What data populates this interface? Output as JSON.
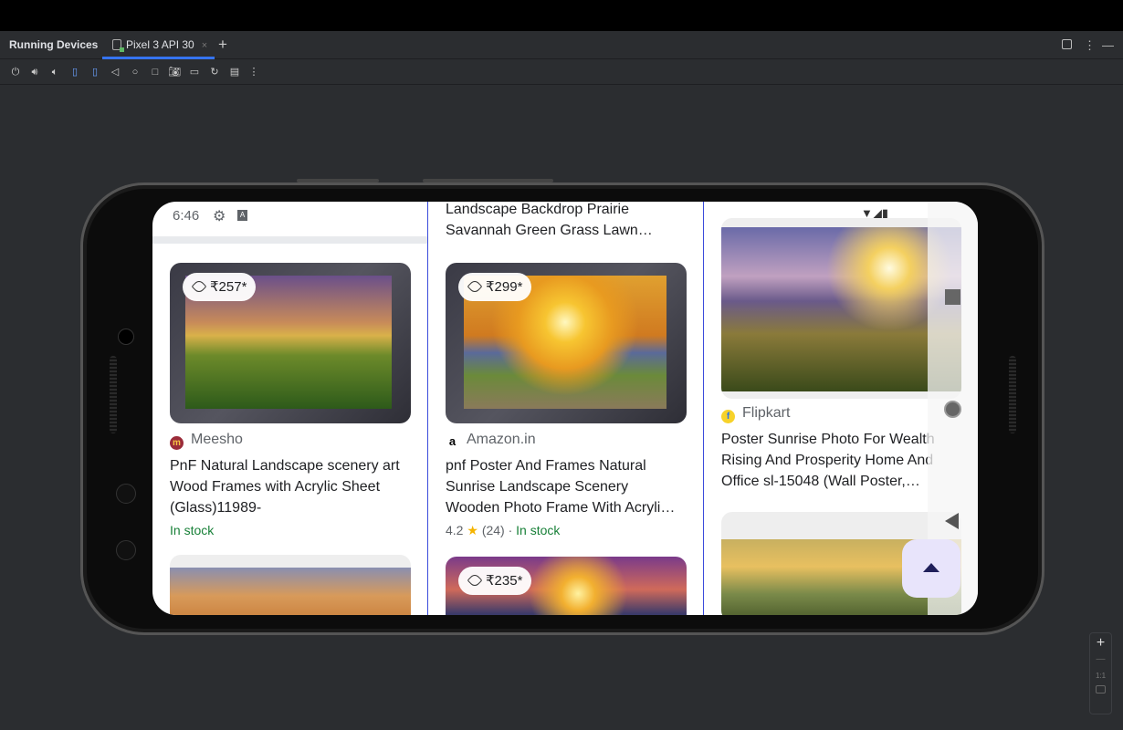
{
  "panel": {
    "title": "Running Devices",
    "tab_label": "Pixel 3 API 30",
    "close": "×",
    "add": "+",
    "more": "⋮",
    "minimize": "—"
  },
  "toolbar": [
    "power",
    "volume-up",
    "volume-down",
    "rotate-left",
    "rotate-right",
    "back",
    "home",
    "overview",
    "screenshot",
    "screen-record",
    "reset",
    "snapshot",
    "more"
  ],
  "zoom": {
    "in": "+",
    "out": "—",
    "actual": "1:1"
  },
  "device": {
    "status_time": "6:46",
    "columns": [
      {
        "header_text": "",
        "cards": [
          {
            "price": "₹257*",
            "source": "Meesho",
            "title_lines": [
              "PnF Natural Landscape scenery art",
              "Wood Frames with Acrylic Sheet",
              "(Glass)11989-"
            ],
            "meta": "In stock"
          }
        ]
      },
      {
        "header_text": [
          "Landscape Backdrop Prairie",
          "Savannah Green Grass Lawn…"
        ],
        "cards": [
          {
            "price": "₹299*",
            "source": "Amazon.in",
            "title_lines": [
              "pnf Poster And Frames Natural",
              "Sunrise Landscape Scenery",
              "Wooden Photo Frame With Acryli…"
            ],
            "rating": "4.2",
            "reviews": "(24)",
            "meta": "In stock"
          },
          {
            "price": "₹235*"
          }
        ]
      },
      {
        "cards": [
          {
            "source": "Flipkart",
            "title_lines": [
              "Poster Sunrise Photo For Wealth",
              "Rising And Prosperity Home And",
              "Office sl-15048 (Wall Poster,…"
            ]
          }
        ]
      }
    ],
    "colors": {
      "accent": "#3574f0",
      "stock": "#188038",
      "divider": "#3b4cdc"
    }
  }
}
